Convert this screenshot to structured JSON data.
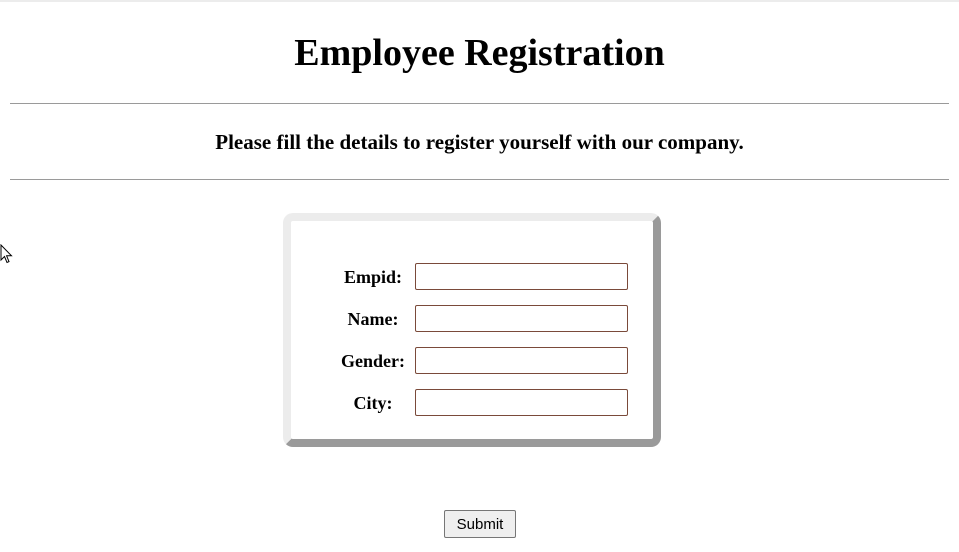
{
  "page": {
    "title": "Employee Registration",
    "subtitle": "Please fill the details to register yourself with our company."
  },
  "form": {
    "fields": [
      {
        "label": "Empid:",
        "value": ""
      },
      {
        "label": "Name:",
        "value": ""
      },
      {
        "label": "Gender:",
        "value": ""
      },
      {
        "label": "City:",
        "value": ""
      }
    ],
    "submit_label": "Submit"
  },
  "icons": {
    "cursor": "mouse-pointer-icon"
  },
  "colors": {
    "box_light_border": "#ececec",
    "box_dark_border": "#9a9a9a",
    "input_border": "#7a4a3a",
    "rule": "#9a9a9a"
  }
}
